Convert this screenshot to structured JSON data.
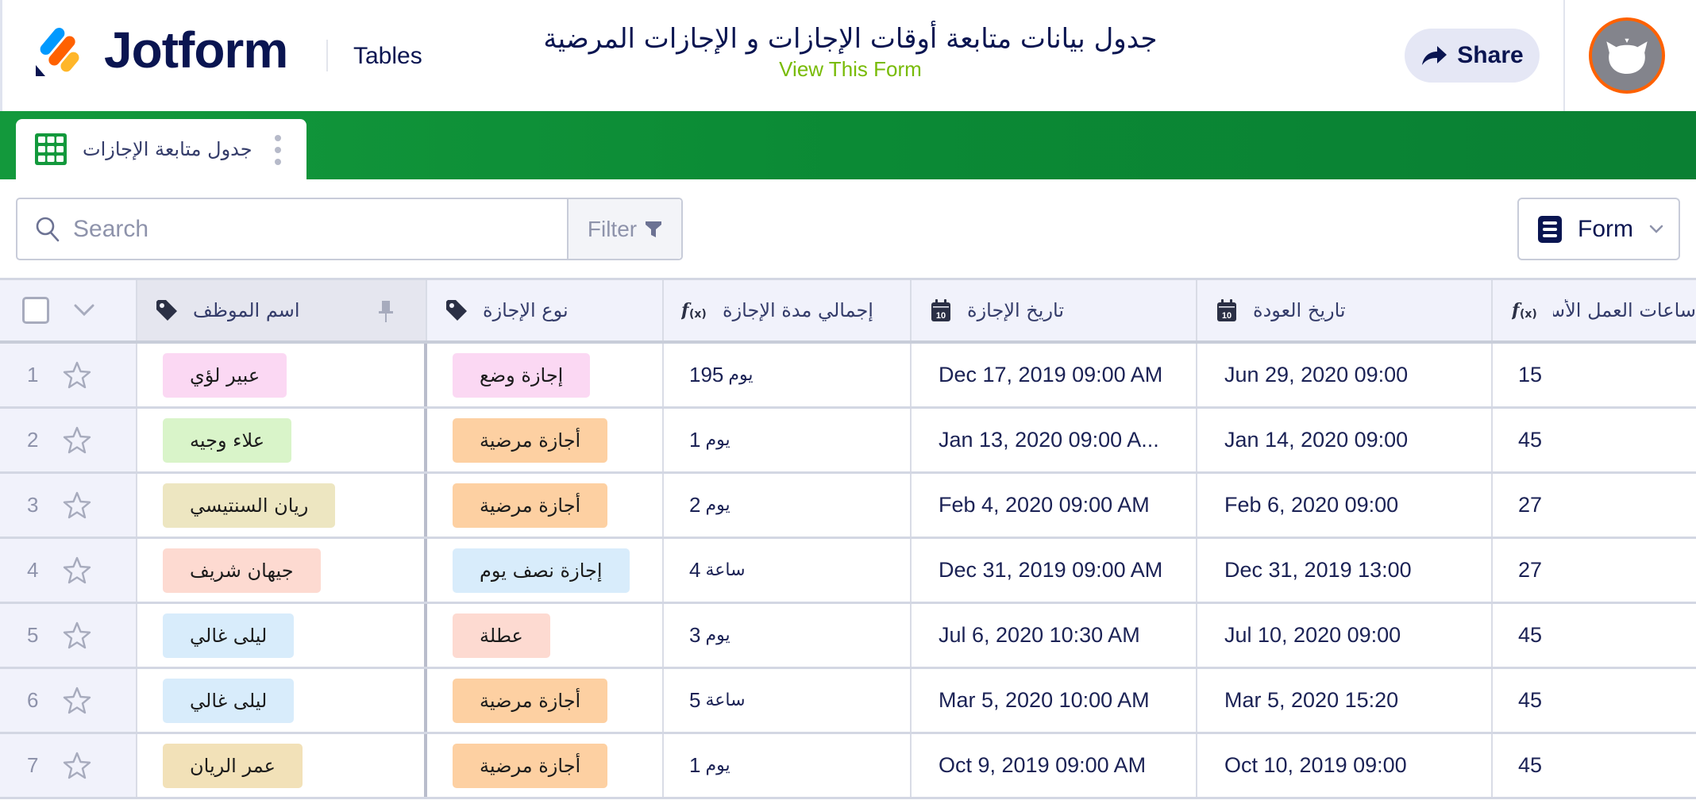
{
  "header": {
    "brand": "Jotform",
    "product": "Tables",
    "page_title": "جدول بيانات متابعة أوقات الإجازات و الإجازات المرضية",
    "view_form_link": "View This Form",
    "share_label": "Share",
    "avatar_icon": "user-avatar-cat-icon"
  },
  "colors": {
    "brand_navy": "#0a1551",
    "green_bar": "#0b8a35",
    "view_form_green": "#78bb07",
    "avatar_ring": "#ff6100",
    "share_bg": "#e5e7f5"
  },
  "tabs": [
    {
      "label": "جدول متابعة الإجازات",
      "icon": "grid-table-icon",
      "active": true
    }
  ],
  "toolbar": {
    "search_placeholder": "Search",
    "search_value": "",
    "filter_label": "Filter",
    "view_selector_label": "Form"
  },
  "table": {
    "columns": [
      {
        "label": "اسم الموظف",
        "icon": "tag-icon",
        "pinned": true
      },
      {
        "label": "نوع الإجازة",
        "icon": "tag-icon"
      },
      {
        "label": "إجمالي مدة الإجازة",
        "icon": "formula-icon"
      },
      {
        "label": "تاريخ الإجازة",
        "icon": "calendar-icon"
      },
      {
        "label": "تاريخ العودة",
        "icon": "calendar-icon"
      },
      {
        "label": "ساعات العمل الأسبوعية",
        "icon": "formula-icon"
      }
    ],
    "rows": [
      {
        "num": "1",
        "employee": "عبير لؤي",
        "employee_color": "#fbd8f3",
        "leave_type": "إجازة وضع",
        "leave_color": "#fbd8f3",
        "duration_value": "195",
        "duration_unit": "يوم",
        "leave_date": "Dec 17, 2019 09:00 AM",
        "return_date": "Jun 29, 2020 09:00",
        "weekly_hours": "15"
      },
      {
        "num": "2",
        "employee": "علاء وجيه",
        "employee_color": "#d9f4c9",
        "leave_type": "أجازة مرضية",
        "leave_color": "#fdd0a2",
        "duration_value": "1",
        "duration_unit": "يوم",
        "leave_date": "Jan 13, 2020 09:00 A...",
        "return_date": "Jan 14, 2020 09:00",
        "weekly_hours": "45"
      },
      {
        "num": "3",
        "employee": "ريان السنتيسي",
        "employee_color": "#ede6c1",
        "leave_type": "أجازة مرضية",
        "leave_color": "#fdd0a2",
        "duration_value": "2",
        "duration_unit": "يوم",
        "leave_date": "Feb 4, 2020 09:00 AM",
        "return_date": "Feb 6, 2020 09:00",
        "weekly_hours": "27"
      },
      {
        "num": "4",
        "employee": "جيهان شريف",
        "employee_color": "#fddad1",
        "leave_type": "إجازة نصف يوم",
        "leave_color": "#d8ecfb",
        "duration_value": "4",
        "duration_unit": "ساعة",
        "leave_date": "Dec 31, 2019 09:00 AM",
        "return_date": "Dec 31, 2019 13:00",
        "weekly_hours": "27"
      },
      {
        "num": "5",
        "employee": "ليلى غالي",
        "employee_color": "#d8ecfb",
        "leave_type": "عطلة",
        "leave_color": "#fddad1",
        "duration_value": "3",
        "duration_unit": "يوم",
        "leave_date": "Jul 6, 2020 10:30 AM",
        "return_date": "Jul 10, 2020 09:00",
        "weekly_hours": "45"
      },
      {
        "num": "6",
        "employee": "ليلى غالي",
        "employee_color": "#d8ecfb",
        "leave_type": "أجازة مرضية",
        "leave_color": "#fdd0a2",
        "duration_value": "5",
        "duration_unit": "ساعة",
        "leave_date": "Mar 5, 2020 10:00 AM",
        "return_date": "Mar 5, 2020 15:20",
        "weekly_hours": "45"
      },
      {
        "num": "7",
        "employee": "عمر الريان",
        "employee_color": "#f2e1b8",
        "leave_type": "أجازة مرضية",
        "leave_color": "#fdd0a2",
        "duration_value": "1",
        "duration_unit": "يوم",
        "leave_date": "Oct 9, 2019 09:00 AM",
        "return_date": "Oct 10, 2019 09:00",
        "weekly_hours": "45"
      }
    ]
  }
}
